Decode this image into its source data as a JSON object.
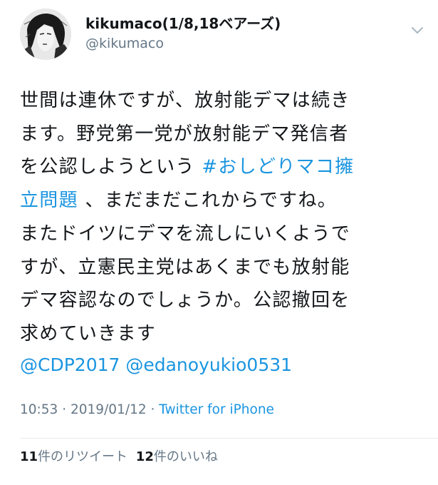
{
  "user": {
    "display_name": "kikumaco(1/8,18ベアーズ)",
    "handle": "@kikumaco"
  },
  "tweet": {
    "lines": [
      {
        "text": "世間は連休ですが、放射能デマは続き"
      },
      {
        "text": "ます。野党第一党が放射能デマ発信者"
      },
      {
        "text": "を公認しようという ",
        "link": "#おしどりマコ擁"
      },
      {
        "link": "立問題",
        "text": " 、まだまだこれからですね。"
      },
      {
        "text": "またドイツにデマを流しにいくようで"
      },
      {
        "text": "すが、立憲民主党はあくまでも放射能"
      },
      {
        "text": "デマ容認なのでしょうか。公認撤回を"
      },
      {
        "text": "求めていきます"
      }
    ],
    "mentions": [
      "@CDP2017",
      "@edanoyukio0531"
    ]
  },
  "meta": {
    "time": "10:53",
    "sep1": " · ",
    "date": "2019/01/12",
    "sep2": " · ",
    "source": "Twitter for iPhone"
  },
  "stats": {
    "retweets_count": "11",
    "retweets_label": "件のリツイート",
    "likes_count": "12",
    "likes_label": "件のいいね"
  },
  "icons": {
    "caret": "chevron-down-icon",
    "avatar": "manga-portrait"
  },
  "colors": {
    "link": "#1b95e0",
    "secondary_text": "#657786",
    "primary_text": "#14171a",
    "divider": "#e6ecf0"
  }
}
